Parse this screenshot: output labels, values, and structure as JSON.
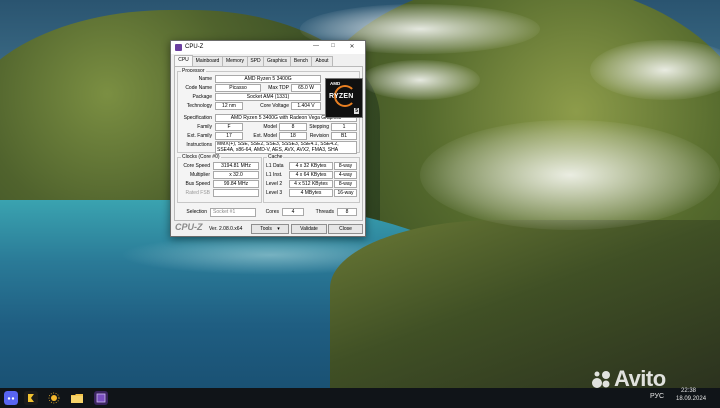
{
  "window": {
    "title": "CPU-Z",
    "controls": {
      "minimize": "—",
      "maximize": "□",
      "close": "✕"
    }
  },
  "tabs": [
    "CPU",
    "Mainboard",
    "Memory",
    "SPD",
    "Graphics",
    "Bench",
    "About"
  ],
  "active_tab": "CPU",
  "processor": {
    "group_title": "Processor",
    "name_label": "Name",
    "name": "AMD Ryzen 5 3400G",
    "code_name_label": "Code Name",
    "code_name": "Picasso",
    "max_tdp_label": "Max TDP",
    "max_tdp": "65.0 W",
    "package_label": "Package",
    "package": "Socket AM4 (1331)",
    "technology_label": "Technology",
    "technology": "12 nm",
    "core_voltage_label": "Core Voltage",
    "core_voltage": "1.404 V",
    "specification_label": "Specification",
    "specification": "AMD Ryzen 5 3400G with Radeon Vega Graphics",
    "family_label": "Family",
    "family": "F",
    "model_label": "Model",
    "model": "8",
    "stepping_label": "Stepping",
    "stepping": "1",
    "ext_family_label": "Ext. Family",
    "ext_family": "17",
    "ext_model_label": "Ext. Model",
    "ext_model": "18",
    "revision_label": "Revision",
    "revision": "B1",
    "instructions_label": "Instructions",
    "instructions": "MMX(+), SSE, SSE2, SSE3, SSSE3, SSE4.1, SSE4.2, SSE4A, x86-64, AMD-V, AES, AVX, AVX2, FMA3, SHA"
  },
  "logo": {
    "brand": "AMD",
    "series": "RYZEN",
    "tier": "5"
  },
  "clocks": {
    "group_title": "Clocks (Core #0)",
    "core_speed_label": "Core Speed",
    "core_speed": "3194.81 MHz",
    "multiplier_label": "Multiplier",
    "multiplier": "x 32.0",
    "bus_speed_label": "Bus Speed",
    "bus_speed": "99.84 MHz",
    "rated_fsb_label": "Rated FSB",
    "rated_fsb": ""
  },
  "cache": {
    "group_title": "Cache",
    "l1_data_label": "L1 Data",
    "l1_data": "4 x 32 KBytes",
    "l1_data_way": "8-way",
    "l1_inst_label": "L1 Inst.",
    "l1_inst": "4 x 64 KBytes",
    "l1_inst_way": "4-way",
    "level2_label": "Level 2",
    "level2": "4 x 512 KBytes",
    "level2_way": "8-way",
    "level3_label": "Level 3",
    "level3": "4 MBytes",
    "level3_way": "16-way"
  },
  "selection": {
    "selection_label": "Selection",
    "socket": "Socket #1",
    "cores_label": "Cores",
    "cores": "4",
    "threads_label": "Threads",
    "threads": "8"
  },
  "footer": {
    "brand": "CPU-Z",
    "version": "Ver. 2.08.0.x64",
    "tools_label": "Tools",
    "validate_label": "Validate",
    "close_label": "Close"
  },
  "watermark": {
    "text": "Avito"
  },
  "taskbar": {
    "language": "РУС",
    "time": "22:38",
    "date": "18.09.2024"
  },
  "colors": {
    "accent": "#6b3fa0",
    "amd_orange": "#e87f22"
  }
}
